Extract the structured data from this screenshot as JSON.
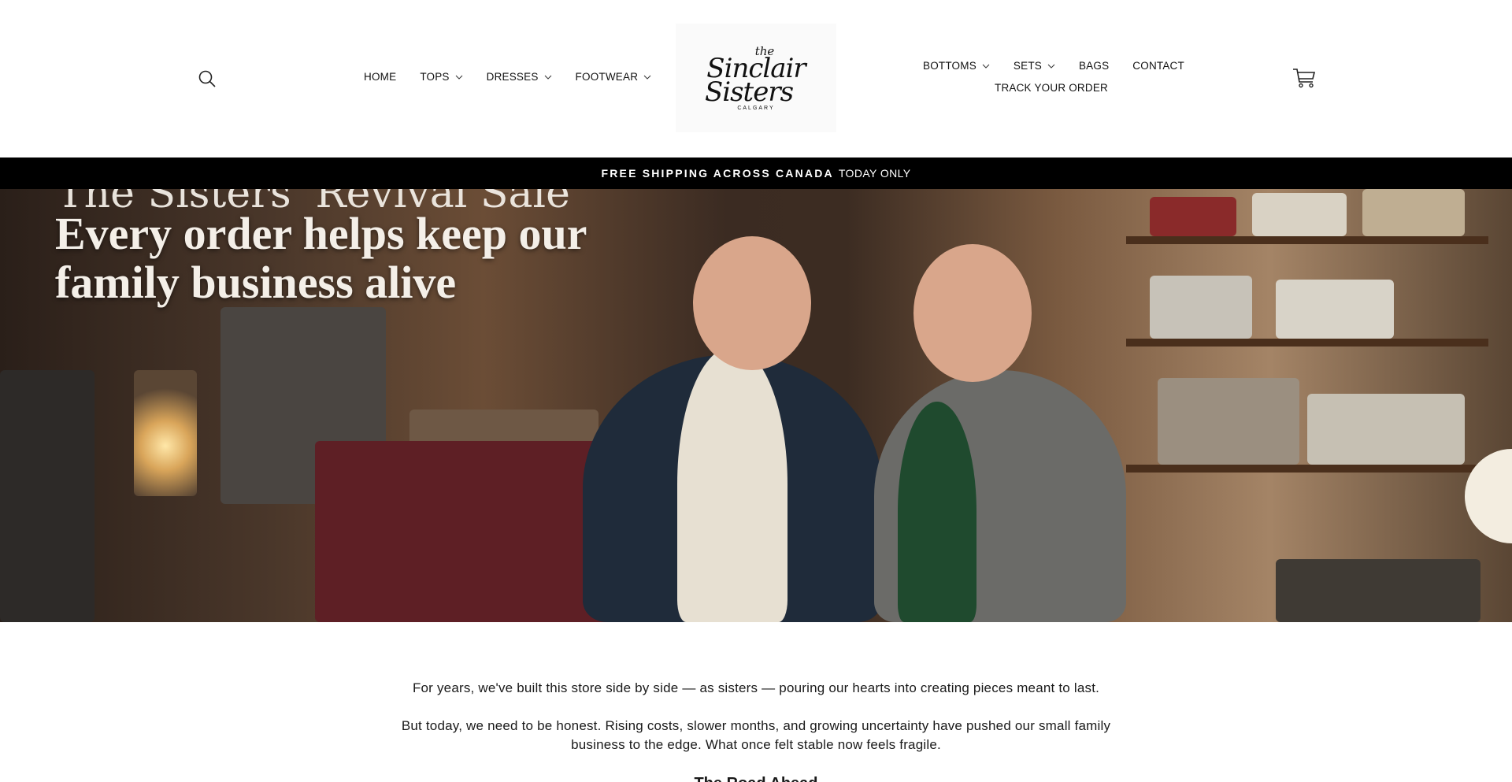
{
  "header": {
    "nav_left": [
      {
        "label": "HOME",
        "has_dropdown": false
      },
      {
        "label": "TOPS",
        "has_dropdown": true
      },
      {
        "label": "DRESSES",
        "has_dropdown": true
      },
      {
        "label": "FOOTWEAR",
        "has_dropdown": true
      }
    ],
    "nav_right": [
      {
        "label": "BOTTOMS",
        "has_dropdown": true
      },
      {
        "label": "SETS",
        "has_dropdown": true
      },
      {
        "label": "BAGS",
        "has_dropdown": false
      },
      {
        "label": "CONTACT",
        "has_dropdown": false
      }
    ],
    "nav_right_second_row": {
      "label": "TRACK YOUR ORDER"
    },
    "logo": {
      "the": "the",
      "line1": "Sinclair",
      "line2": "Sisters",
      "city": "CALGARY"
    },
    "icons": {
      "search": "search-icon",
      "cart": "cart-icon",
      "dropdown": "chevron-down-icon"
    }
  },
  "announcement": {
    "bold": "FREE SHIPPING ACROSS CANADA",
    "light": "TODAY ONLY"
  },
  "hero": {
    "headline_cut": "The Sisters' Revival Sale",
    "headline": "Every order helps keep our family business alive"
  },
  "story": {
    "paragraph1": "For years, we've built this store side by side — as sisters — pouring our hearts into creating pieces meant to last.",
    "paragraph2": "But today, we need to be honest. Rising costs, slower months, and growing uncertainty have pushed our small family business to the edge. What once felt stable now feels fragile.",
    "subheading": "The Road Ahead"
  },
  "colors": {
    "announcement_bg": "#000000",
    "text": "#111111",
    "background": "#ffffff"
  }
}
